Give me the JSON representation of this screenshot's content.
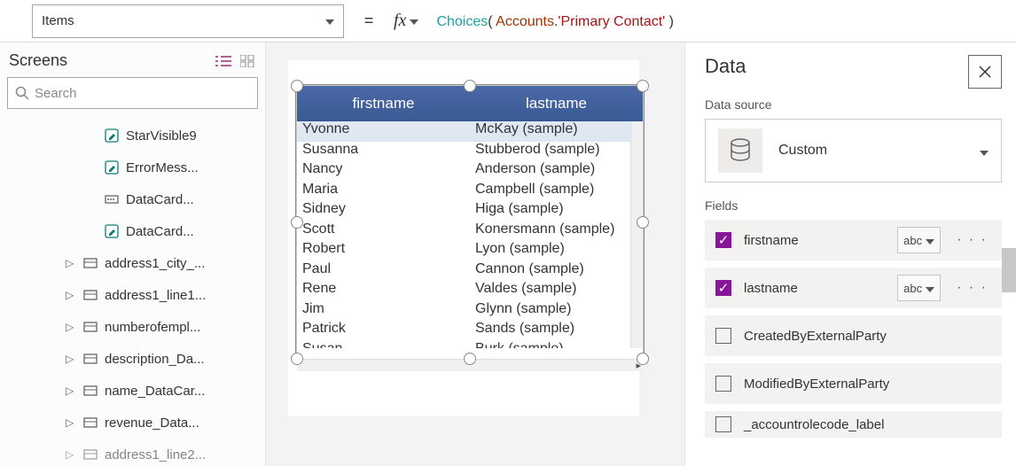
{
  "topbar": {
    "property": "Items",
    "equals": "=",
    "fx": "fx",
    "formula": {
      "fn": "Choices",
      "open": "( ",
      "id": "Accounts",
      "dot": ".",
      "str": "'Primary Contact'",
      "close": " )"
    }
  },
  "left": {
    "title": "Screens",
    "search_placeholder": "Search",
    "children": [
      "StarVisible9",
      "ErrorMess...",
      "DataCard...",
      "DataCard..."
    ],
    "parents": [
      "address1_city_...",
      "address1_line1...",
      "numberofempl...",
      "description_Da...",
      "name_DataCar...",
      "revenue_Data...",
      "address1_line2..."
    ]
  },
  "datatable": {
    "headers": [
      "firstname",
      "lastname"
    ],
    "rows": [
      [
        "Yvonne",
        "McKay (sample)"
      ],
      [
        "Susanna",
        "Stubberod (sample)"
      ],
      [
        "Nancy",
        "Anderson (sample)"
      ],
      [
        "Maria",
        "Campbell (sample)"
      ],
      [
        "Sidney",
        "Higa (sample)"
      ],
      [
        "Scott",
        "Konersmann (sample)"
      ],
      [
        "Robert",
        "Lyon (sample)"
      ],
      [
        "Paul",
        "Cannon (sample)"
      ],
      [
        "Rene",
        "Valdes (sample)"
      ],
      [
        "Jim",
        "Glynn (sample)"
      ],
      [
        "Patrick",
        "Sands (sample)"
      ],
      [
        "Susan",
        "Burk (sample)"
      ]
    ]
  },
  "right": {
    "title": "Data",
    "ds_label": "Data source",
    "ds_name": "Custom",
    "fields_label": "Fields",
    "fields": [
      {
        "name": "firstname",
        "checked": true,
        "type": "abc"
      },
      {
        "name": "lastname",
        "checked": true,
        "type": "abc"
      },
      {
        "name": "CreatedByExternalParty",
        "checked": false
      },
      {
        "name": "ModifiedByExternalParty",
        "checked": false
      },
      {
        "name": "_accountrolecode_label",
        "checked": false
      }
    ]
  }
}
